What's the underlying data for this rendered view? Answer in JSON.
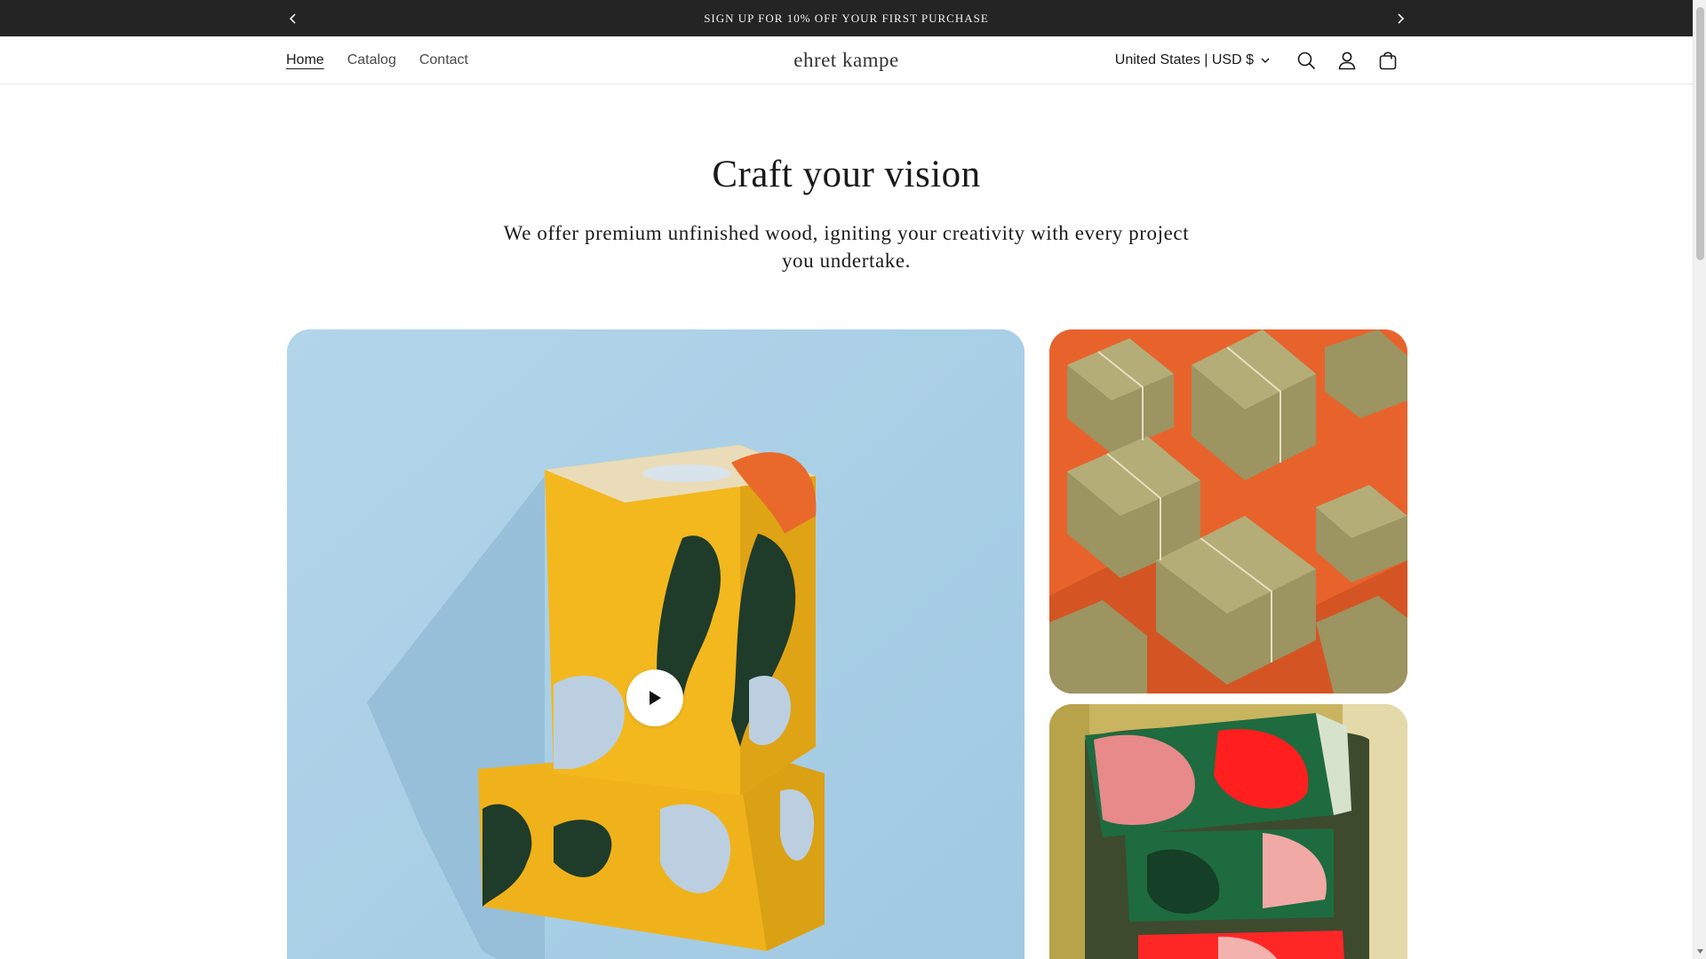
{
  "announcement": {
    "text": "SIGN UP FOR 10% OFF YOUR FIRST PURCHASE",
    "prev_icon": "chevron-left-icon",
    "next_icon": "chevron-right-icon"
  },
  "header": {
    "nav": [
      {
        "label": "Home",
        "active": true
      },
      {
        "label": "Catalog",
        "active": false
      },
      {
        "label": "Contact",
        "active": false
      }
    ],
    "logo": "ehret kampe",
    "country_selector": "United States | USD $",
    "icons": [
      "search-icon",
      "account-icon",
      "cart-icon"
    ]
  },
  "hero": {
    "title": "Craft your vision",
    "subtitle": "We offer premium unfinished wood, igniting your creativity with every project you undertake."
  },
  "media": {
    "main": "video of stacked yellow patterned boxes on light blue background",
    "side1": "kraft gift boxes on orange background",
    "side2": "person holding stack of red and green patterned boxes",
    "play_icon": "play-icon"
  },
  "colors": {
    "announcement_bg": "#242424",
    "hero_blue": "#a9cde4",
    "accent_orange": "#e8632c",
    "box_yellow": "#f0b21b",
    "leaf_green": "#1f3b2a"
  }
}
